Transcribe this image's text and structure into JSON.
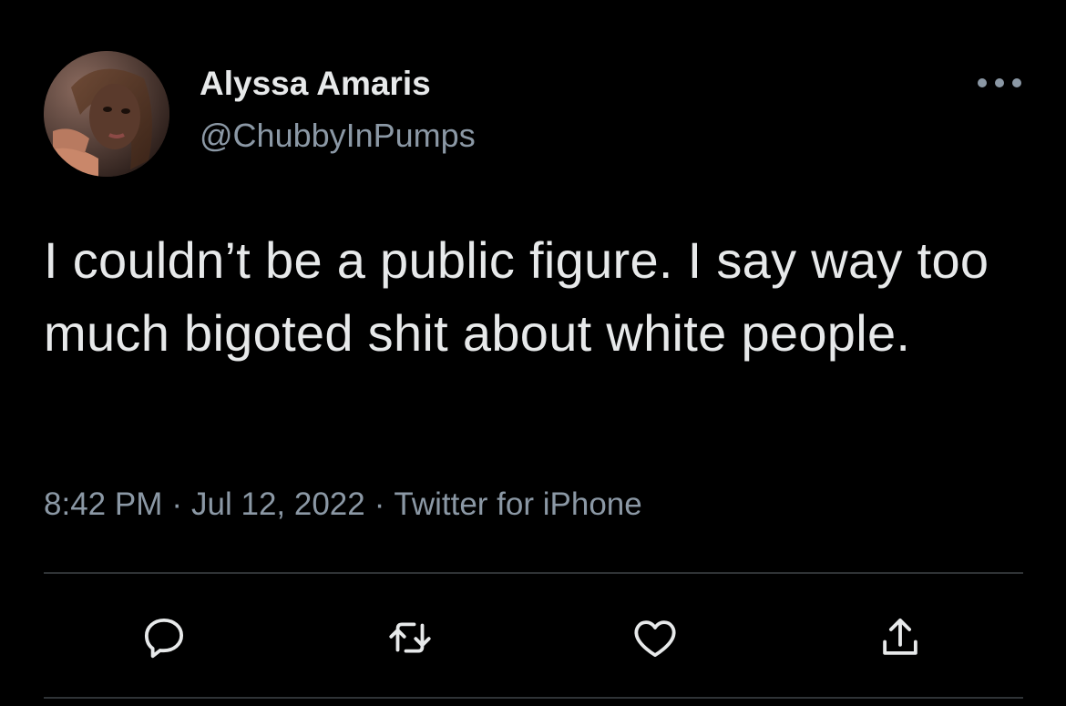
{
  "author": {
    "display_name": "Alyssa Amaris",
    "handle": "@ChubbyInPumps"
  },
  "tweet": {
    "text": "I couldn’t be a public figure. I say way too much bigoted shit about white people."
  },
  "meta": {
    "time": "8:42 PM",
    "separator": "·",
    "date": "Jul 12, 2022",
    "source": "Twitter for iPhone"
  },
  "icons": {
    "more": "more-horizontal-icon",
    "reply": "reply-icon",
    "retweet": "retweet-icon",
    "like": "heart-icon",
    "share": "share-icon"
  },
  "colors": {
    "background": "#000000",
    "primary_text": "#e7e9ea",
    "secondary_text": "#8b98a5",
    "divider": "#2f3336"
  }
}
